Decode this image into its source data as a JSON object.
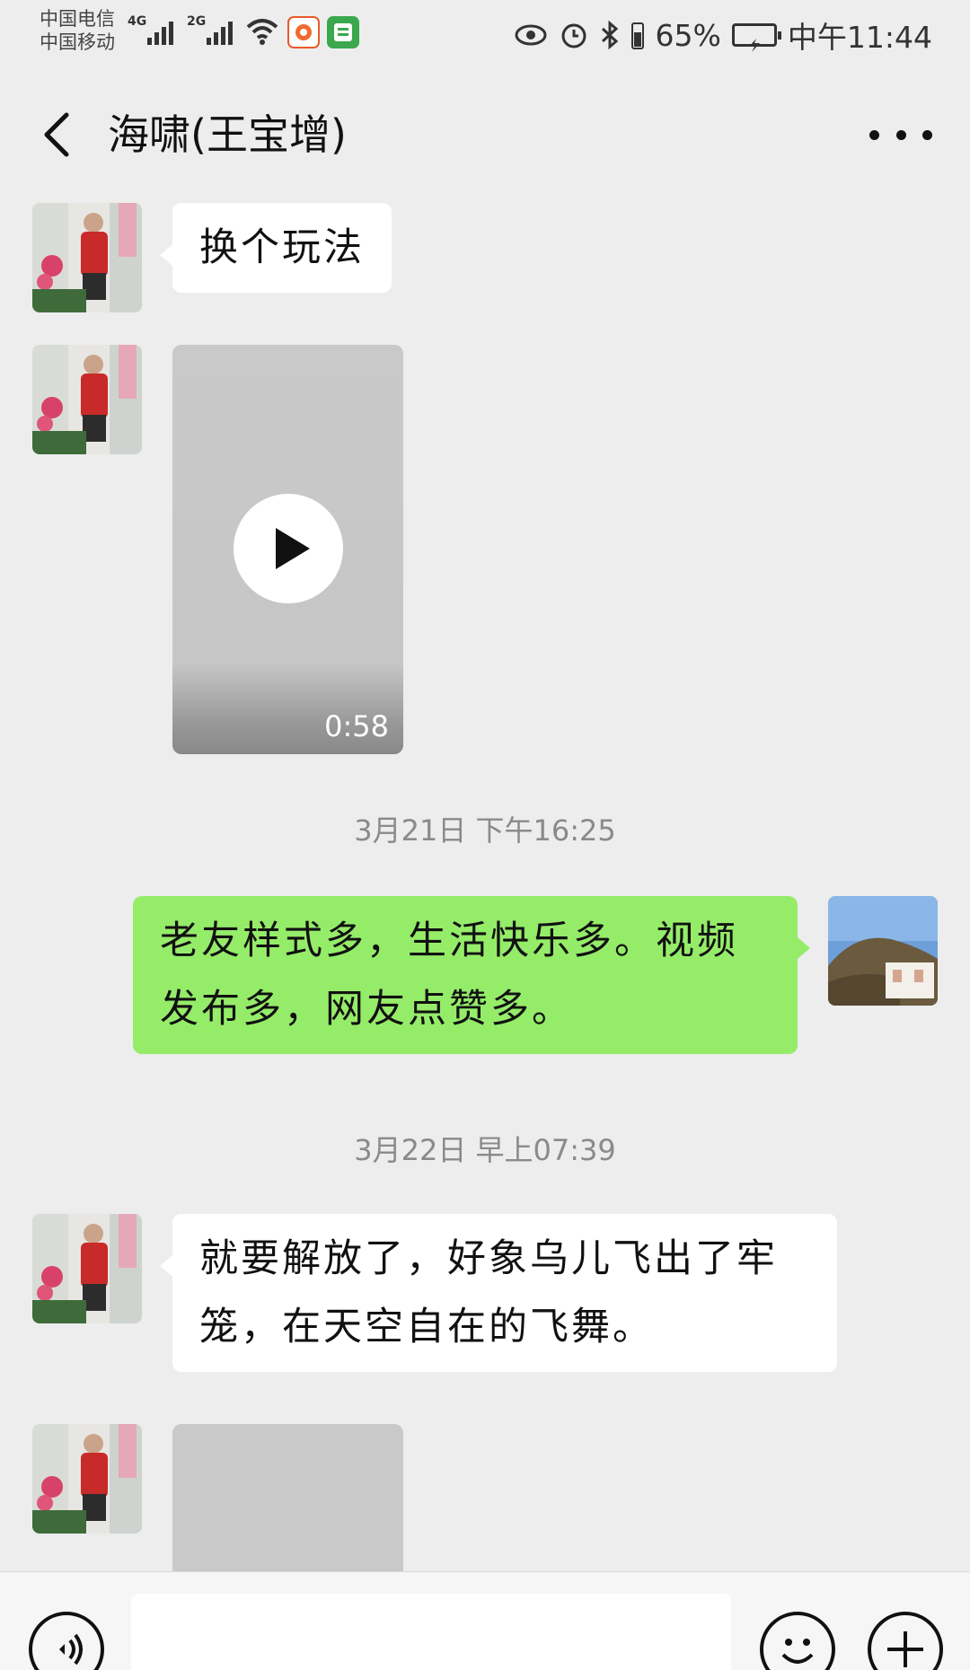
{
  "status_bar": {
    "carrier_1": "中国电信",
    "carrier_2": "中国移动",
    "network_1": "4G",
    "network_2": "2G",
    "battery": "65%",
    "time": "中午11:44",
    "icons": [
      "eye-icon",
      "alarm-icon",
      "bluetooth-icon",
      "battery-icon",
      "charging-icon",
      "wifi-icon",
      "signal-icon"
    ]
  },
  "header": {
    "title": "海啸(王宝增)",
    "back_icon": "chevron-left-icon",
    "more_icon": "more-dots-icon"
  },
  "messages": [
    {
      "type": "text",
      "direction": "in",
      "text": "换个玩法"
    },
    {
      "type": "video",
      "direction": "in",
      "duration": "0:58"
    },
    {
      "type": "timestamp",
      "text": "3月21日 下午16:25"
    },
    {
      "type": "text",
      "direction": "out",
      "text": "老友样式多，生活快乐多。视频发布多，网友点赞多。"
    },
    {
      "type": "timestamp",
      "text": "3月22日 早上07:39"
    },
    {
      "type": "text",
      "direction": "in",
      "text": "就要解放了，好象乌儿飞出了牢笼，在天空自在的飞舞。"
    },
    {
      "type": "media-placeholder",
      "direction": "in"
    }
  ],
  "input_bar": {
    "voice_icon": "voice-icon",
    "emoji_icon": "emoji-icon",
    "plus_icon": "plus-icon"
  },
  "colors": {
    "background": "#ededed",
    "incoming_bubble": "#ffffff",
    "outgoing_bubble": "#95ec69",
    "timestamp": "#8a8a8a"
  }
}
